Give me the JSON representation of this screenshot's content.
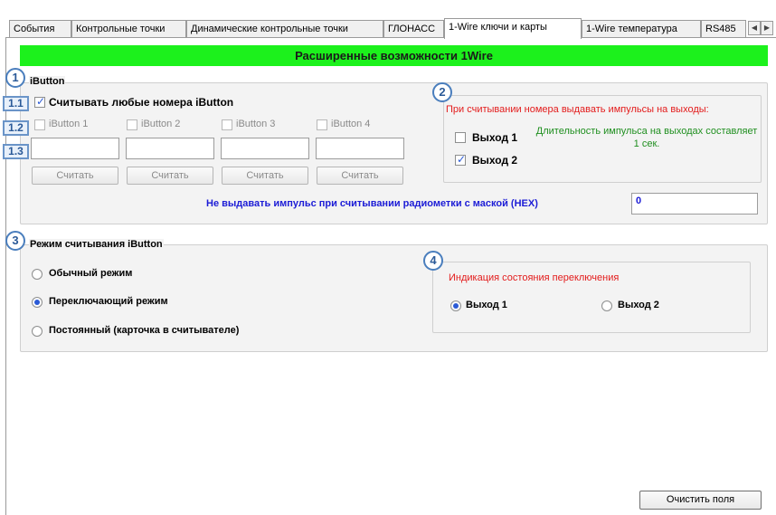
{
  "tabs": [
    {
      "label": "События",
      "active": false
    },
    {
      "label": "Контрольные точки",
      "active": false
    },
    {
      "label": "Динамические контрольные точки",
      "active": false
    },
    {
      "label": "ГЛОНАСС",
      "active": false
    },
    {
      "label": "1-Wire ключи и карты",
      "active": true
    },
    {
      "label": "1-Wire температура",
      "active": false
    },
    {
      "label": "RS485",
      "active": false
    }
  ],
  "banner": "Расширенные возможности 1Wire",
  "callouts": {
    "c1": "1",
    "c2": "2",
    "c3": "3",
    "c4": "4",
    "t11": "1.1",
    "t12": "1.2",
    "t13": "1.3"
  },
  "ibutton": {
    "title": "iButton",
    "read_any_label": "Считывать любые номера iButton",
    "read_any_checked": true,
    "items": [
      {
        "label": "iButton 1",
        "value": "",
        "button": "Считать"
      },
      {
        "label": "iButton 2",
        "value": "",
        "button": "Считать"
      },
      {
        "label": "iButton 3",
        "value": "",
        "button": "Считать"
      },
      {
        "label": "iButton 4",
        "value": "",
        "button": "Считать"
      }
    ],
    "outputs_title": "При считывании номера выдавать импульсы на выходы:",
    "output1_label": "Выход 1",
    "output1_checked": false,
    "output2_label": "Выход 2",
    "output2_checked": true,
    "pulse_note": "Длительность импульса на выходах составляет 1 сек.",
    "mask_label": "Не выдавать импульс при считывании радиометки с маской (HEX)",
    "mask_value": "0"
  },
  "mode": {
    "title": "Режим считывания iButton",
    "options": [
      {
        "label": "Обычный режим",
        "selected": false
      },
      {
        "label": "Переключающий режим",
        "selected": true
      },
      {
        "label": "Постоянный (карточка в считывателе)",
        "selected": false
      }
    ],
    "indication_title": "Индикация состояния переключения",
    "indication_options": [
      {
        "label": "Выход 1",
        "selected": true
      },
      {
        "label": "Выход 2",
        "selected": false
      }
    ]
  },
  "clear_button": "Очистить поля",
  "colors": {
    "banner": "#1cf11c",
    "accent_blue": "#1c1cd6",
    "red_title": "#e31b1b",
    "green_note": "#1f8f1f"
  }
}
